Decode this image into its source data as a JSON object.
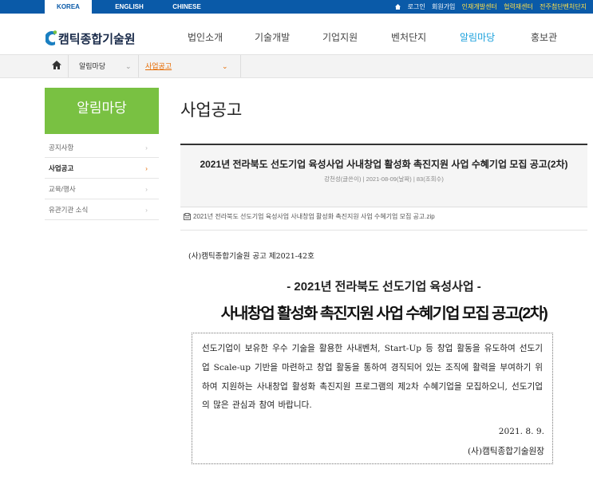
{
  "topbar": {
    "languages": [
      {
        "label": "KOREA",
        "active": true
      },
      {
        "label": "ENGLISH",
        "active": false
      },
      {
        "label": "CHINESE",
        "active": false
      }
    ],
    "utils": {
      "home_icon": "home-icon",
      "login": "로그인",
      "join": "회원가입",
      "talent": "인재개발센터",
      "forum": "협력재센터",
      "jeonju": "전주첨단벤처단지"
    }
  },
  "header": {
    "logo_text": "캠틱종합기술원",
    "nav": [
      "법인소개",
      "기술개발",
      "기업지원",
      "벤처단지",
      "알림마당",
      "홍보관"
    ],
    "active_nav": "알림마당"
  },
  "breadcrumb": {
    "home_icon": "home-icon",
    "level1": "알림마당",
    "level2": "사업공고"
  },
  "sidebar": {
    "title": "알림마당",
    "items": [
      {
        "label": "공지사항",
        "active": false
      },
      {
        "label": "사업공고",
        "active": true
      },
      {
        "label": "교육/행사",
        "active": false
      },
      {
        "label": "유관기관 소식",
        "active": false
      }
    ]
  },
  "main": {
    "page_title": "사업공고",
    "post": {
      "title": "2021년 전라북도 선도기업 육성사업 사내창업 활성화 촉진지원 사업 수혜기업 모집 공고(2차)",
      "meta": "강천성(글쓴이) | 2021-08-09(날짜) | 83(조회수)",
      "attachment": "2021년 전라북도 선도기업 육성사업 사내창업 활성화 촉진지원 사업 수혜기업 모집 공고.zip"
    },
    "notice_no": "(사)캠틱종합기술원 공고 제2021-42호",
    "sub_heading": "- 2021년 전라북도 선도기업 육성사업 -",
    "main_heading": "사내창업 활성화 촉진지원 사업 수혜기업 모집 공고(2차)",
    "body": "선도기업이 보유한 우수 기술을 활용한 사내벤처, Start-Up 등 창업 활동을 유도하여 선도기업 Scale-up 기반을 마련하고 창업 활동을 통하여 경직되어 있는 조직에 활력을 부여하기 위하여 지원하는 사내창업 활성화 촉진지원 프로그램의 제2차 수혜기업을 모집하오니, 선도기업의 많은 관심과 참여 바랍니다.",
    "date": "2021. 8. 9.",
    "signature": "(사)캠틱종합기술원장"
  },
  "colors": {
    "topbar": "#0a5aa8",
    "sidebar_head": "#79c142",
    "active_orange": "#e66a00",
    "nav_active": "#19a0dc"
  }
}
